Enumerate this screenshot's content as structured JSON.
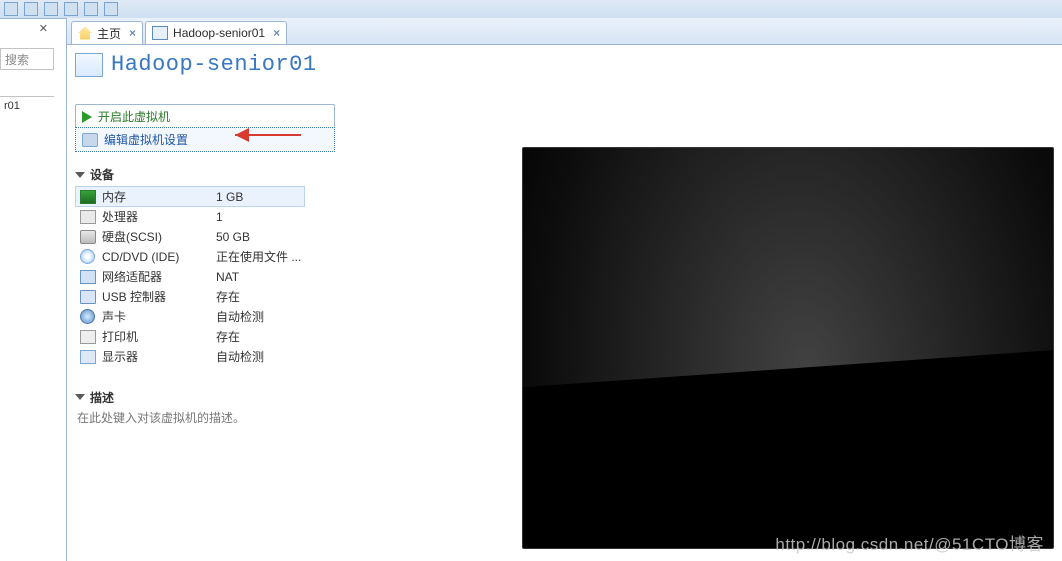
{
  "toolbar": {},
  "leftcol": {
    "search_placeholder": "搜索",
    "library_item": "r01"
  },
  "tabs": {
    "home": "主页",
    "vm": "Hadoop-senior01"
  },
  "vm": {
    "title": "Hadoop-senior01",
    "actions": {
      "power_on": "开启此虚拟机",
      "edit": "编辑虚拟机设置"
    },
    "sections": {
      "devices": "设备",
      "description": "描述"
    },
    "devices": [
      {
        "icon": "ic-mem",
        "name": "内存",
        "value": "1 GB"
      },
      {
        "icon": "ic-cpu",
        "name": "处理器",
        "value": "1"
      },
      {
        "icon": "ic-hdd",
        "name": "硬盘(SCSI)",
        "value": "50 GB"
      },
      {
        "icon": "ic-cd",
        "name": "CD/DVD (IDE)",
        "value": "正在使用文件 ..."
      },
      {
        "icon": "ic-net",
        "name": "网络适配器",
        "value": "NAT"
      },
      {
        "icon": "ic-usb",
        "name": "USB 控制器",
        "value": "存在"
      },
      {
        "icon": "ic-snd",
        "name": "声卡",
        "value": "自动检测"
      },
      {
        "icon": "ic-prn",
        "name": "打印机",
        "value": "存在"
      },
      {
        "icon": "ic-disp",
        "name": "显示器",
        "value": "自动检测"
      }
    ],
    "description_placeholder": "在此处键入对该虚拟机的描述。"
  },
  "watermark": "http://blog.csdn.net/@51CTO博客"
}
